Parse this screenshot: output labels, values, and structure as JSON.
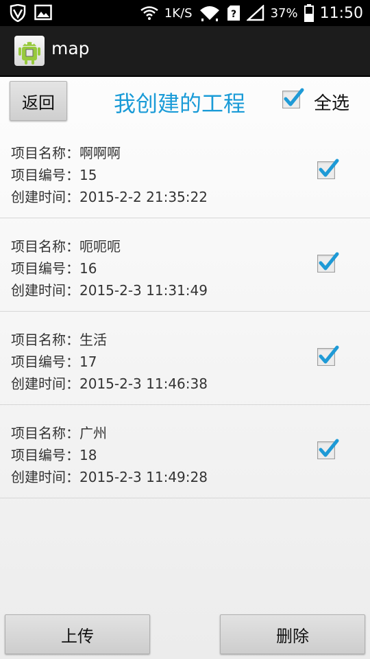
{
  "status_bar": {
    "speed": "1K/S",
    "battery": "37%",
    "time": "11:50",
    "icons": [
      "shield-icon",
      "image-icon",
      "wifi-icon",
      "wifi-transfer-icon",
      "sim-unknown-icon",
      "signal-icon",
      "battery-icon"
    ]
  },
  "app": {
    "title": "map",
    "icon": "android-app-icon"
  },
  "header": {
    "back_label": "返回",
    "title": "我创建的工程",
    "select_all_label": "全选",
    "select_all_checked": true
  },
  "projects": [
    {
      "name": "项目名称：啊啊啊",
      "number": "项目编号：15",
      "created": "创建时间：2015-2-2 21:35:22",
      "checked": true
    },
    {
      "name": "项目名称：呃呃呃",
      "number": "项目编号：16",
      "created": "创建时间：2015-2-3 11:31:49",
      "checked": true
    },
    {
      "name": "项目名称：生活",
      "number": "项目编号：17",
      "created": "创建时间：2015-2-3 11:46:38",
      "checked": true
    },
    {
      "name": "项目名称：广州",
      "number": "项目编号：18",
      "created": "创建时间：2015-2-3 11:49:28",
      "checked": true
    }
  ],
  "footer": {
    "upload_label": "上传",
    "delete_label": "删除"
  },
  "colors": {
    "accent": "#1a9bd7",
    "check": "#1e9ad6",
    "actionbar": "#1c1c1c"
  }
}
